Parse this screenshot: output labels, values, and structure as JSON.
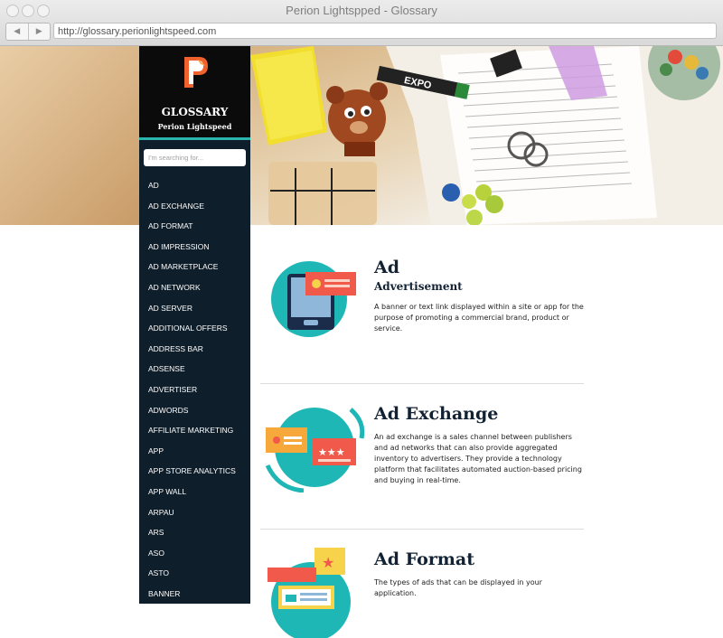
{
  "window": {
    "title": "Perion Lightspped - Glossary"
  },
  "browser": {
    "url": "http://glossary.perionlightspeed.com",
    "back_icon": "back-arrow-icon",
    "forward_icon": "forward-arrow-icon"
  },
  "sidebar": {
    "logo_letter": "P",
    "title": "GLOSSARY",
    "subtitle": "Perion Lightspeed",
    "search_placeholder": "I'm searching for...",
    "items": [
      "AD",
      "AD EXCHANGE",
      "AD FORMAT",
      "AD IMPRESSION",
      "AD MARKETPLACE",
      "AD NETWORK",
      "AD SERVER",
      "ADDITIONAL OFFERS",
      "ADDRESS BAR",
      "ADSENSE",
      "ADVERTISER",
      "ADWORDS",
      "AFFILIATE MARKETING",
      "APP",
      "APP STORE ANALYTICS",
      "APP WALL",
      "ARPAU",
      "ARS",
      "ASO",
      "ASTO",
      "BANNER"
    ]
  },
  "hero": {
    "marker_text": "EXPO"
  },
  "entries": [
    {
      "term": "Ad",
      "subtitle": "Advertisement",
      "definition": "A banner or text link displayed within a site or app for the purpose of promoting a commercial brand, product or service."
    },
    {
      "term": "Ad Exchange",
      "definition": "An ad exchange is a sales channel between publishers and ad networks that can also provide aggregated inventory to advertisers. They provide a technology platform that facilitates automated auction-based pricing and buying in real-time."
    },
    {
      "term": "Ad Format",
      "definition": "The types of ads that can be displayed in your application."
    }
  ],
  "colors": {
    "sidebar_bg": "#0e1e2b",
    "accent": "#2bb3ad",
    "heading": "#122233",
    "logo_orange": "#f0622d"
  }
}
